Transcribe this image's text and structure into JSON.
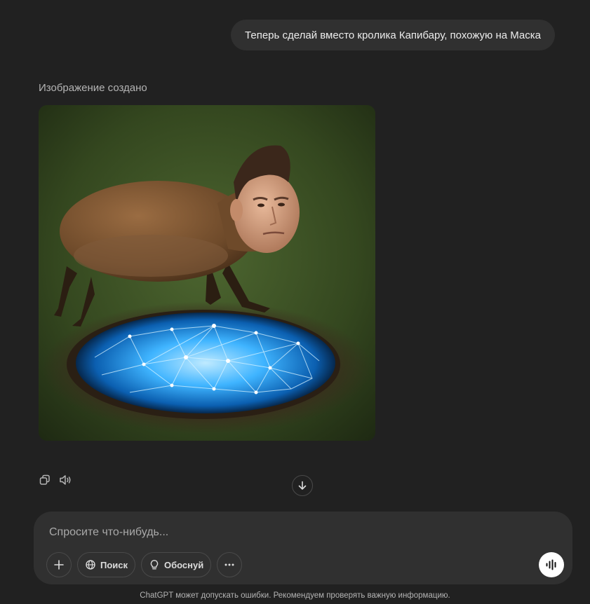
{
  "conversation": {
    "user_message": "Теперь сделай вместо кролика Капибару, похожую на Маска",
    "assistant_status": "Изображение создано",
    "generated_image": {
      "subject": "capybara with human head jumping over glowing blue portal on grass"
    }
  },
  "message_actions": {
    "copy_icon": "copy-icon",
    "read_aloud_icon": "speaker-icon"
  },
  "scroll": {
    "icon": "arrow-down-icon"
  },
  "composer": {
    "placeholder": "Спросите что-нибудь...",
    "value": "",
    "tools": {
      "add_icon": "plus-icon",
      "search_label": "Поиск",
      "reason_label": "Обоснуй",
      "more_icon": "ellipsis-icon"
    },
    "voice_icon": "voice-waveform-icon"
  },
  "footer": {
    "disclaimer": "ChatGPT может допускать ошибки. Рекомендуем проверять важную информацию."
  },
  "colors": {
    "background": "#212121",
    "bubble": "#303030",
    "composer": "#303030",
    "portal": "#2aa8ff"
  }
}
